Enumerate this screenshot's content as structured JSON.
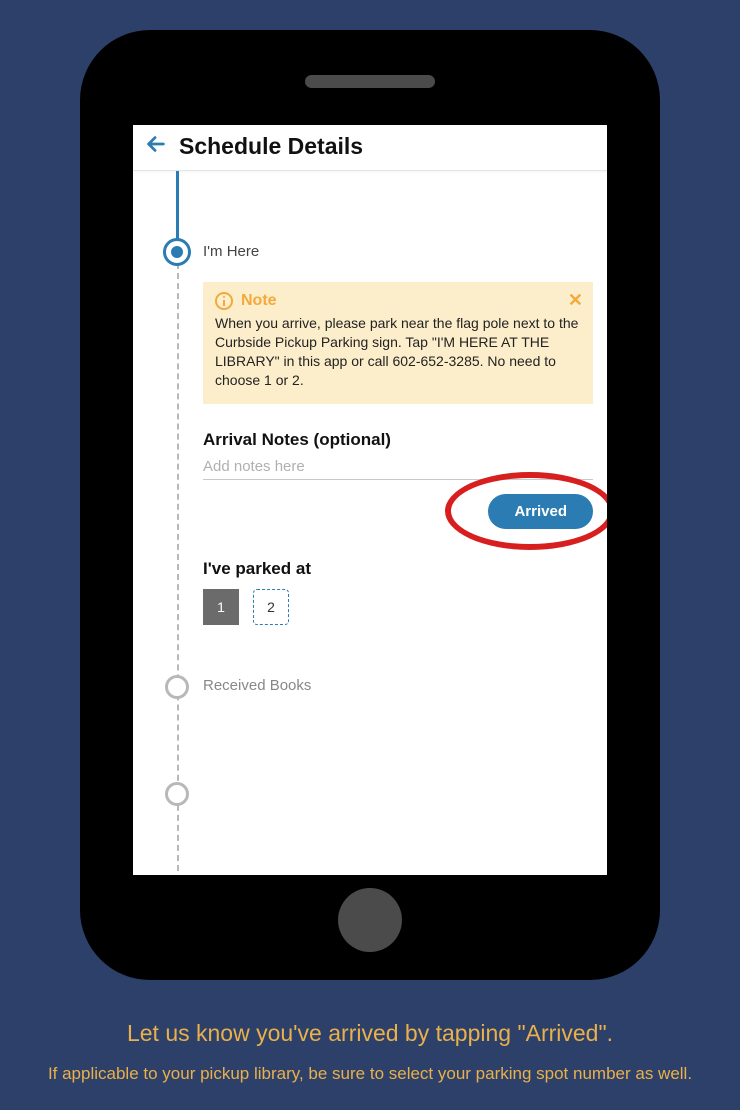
{
  "header": {
    "title": "Schedule Details"
  },
  "steps": {
    "here": {
      "title": "I'm Here"
    },
    "received": {
      "title": "Received Books"
    }
  },
  "note": {
    "title": "Note",
    "body": "When you arrive, please park near the flag pole next to the Curbside Pickup Parking sign. Tap \"I'M HERE AT THE LIBRARY\" in this app or call 602-652-3285. No need to choose 1 or 2."
  },
  "arrival": {
    "label": "Arrival Notes (optional)",
    "placeholder": "Add notes here",
    "button": "Arrived"
  },
  "parked": {
    "label": "I've parked at",
    "options": [
      "1",
      "2"
    ],
    "selected": "1"
  },
  "caption": {
    "main": "Let us know you've arrived by tapping \"Arrived\".",
    "sub": "If applicable to your pickup library,  be sure to select your parking spot number as well."
  },
  "colors": {
    "accent": "#2b7cb3",
    "note_bg": "#fdeecb",
    "note_accent": "#f3a93c",
    "page_bg": "#2c4069",
    "highlight": "#d81f1f",
    "caption": "#e9b04b"
  }
}
